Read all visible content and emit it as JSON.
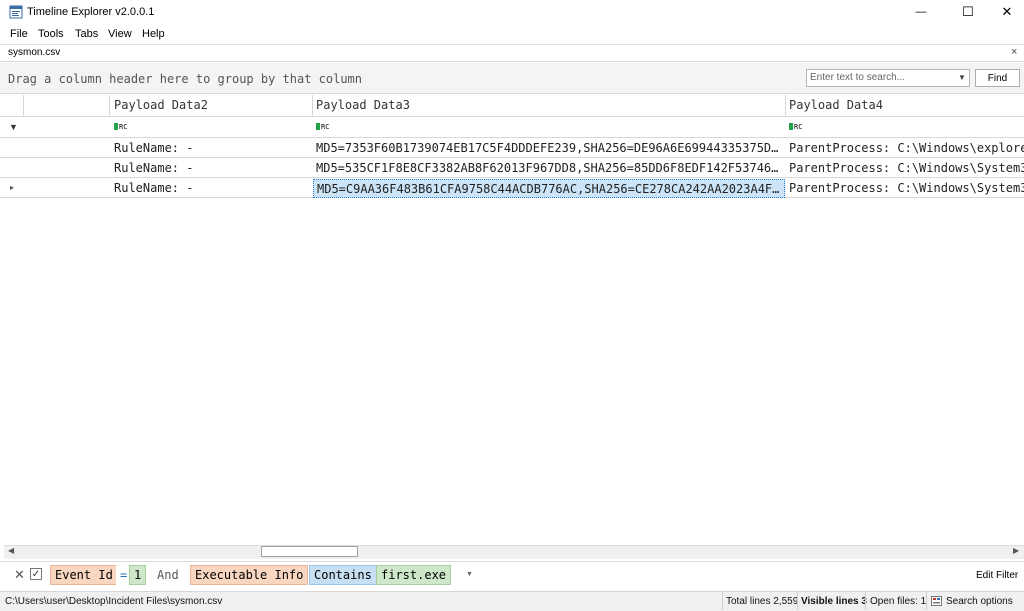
{
  "window": {
    "title": "Timeline Explorer v2.0.0.1",
    "minimize_glyph": "—",
    "maximize_glyph": "☐",
    "close_glyph": "✕"
  },
  "menu": [
    "File",
    "Tools",
    "Tabs",
    "View",
    "Help"
  ],
  "tab": {
    "label": "sysmon.csv",
    "close_glyph": "×"
  },
  "group_panel": {
    "text": "Drag a column header here to group by that column"
  },
  "search": {
    "placeholder": "Enter text to search...",
    "find_label": "Find"
  },
  "grid": {
    "columns": [
      "Payload Data2",
      "Payload Data3",
      "Payload Data4"
    ],
    "filter_icon": "RC",
    "rows": [
      {
        "payload2": "RuleName: -",
        "payload3": "MD5=7353F60B1739074EB17C5F4DDDEFE239,SHA256=DE96A6E69944335375D…",
        "payload4": "ParentProcess: C:\\Windows\\explore"
      },
      {
        "payload2": "RuleName: -",
        "payload3": "MD5=535CF1F8E8CF3382AB8F62013F967DD8,SHA256=85DD6F8EDF142F53746…",
        "payload4": "ParentProcess: C:\\Windows\\System3"
      },
      {
        "payload2": "RuleName: -",
        "payload3": "MD5=C9AA36F483B61CFA9758C44ACDB776AC,SHA256=CE278CA242AA2023A4F…",
        "payload4": "ParentProcess: C:\\Windows\\System3"
      }
    ]
  },
  "filter": {
    "field1": "Event Id",
    "op1": "=",
    "value1": "1",
    "joiner": "And",
    "field2": "Executable Info",
    "op2": "Contains",
    "value2": "first.exe",
    "edit_label": "Edit Filter"
  },
  "status": {
    "path": "C:\\Users\\user\\Desktop\\Incident Files\\sysmon.csv",
    "total_lines": "Total lines 2,559",
    "visible_lines": "Visible lines 3",
    "open_files": "Open files: 1",
    "search_options": "Search options"
  },
  "colors": {
    "chip_field": "#f9d6c0",
    "chip_op": "#c6dff3",
    "chip_value": "#cfe7c9",
    "selection": "#cce4f7",
    "filter_icon_green": "#22a34a"
  }
}
